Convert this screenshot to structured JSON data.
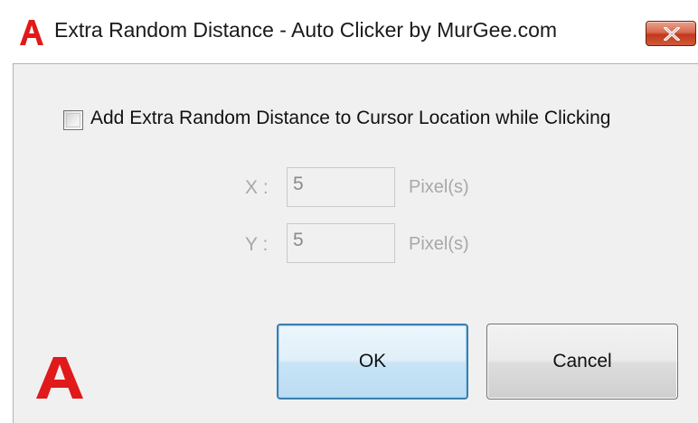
{
  "window": {
    "title": "Extra Random Distance - Auto Clicker by MurGee.com",
    "logo_icon": "murgee-a-logo-icon",
    "accent_color": "#e01a1a"
  },
  "options": {
    "random_distance_checkbox": {
      "label": "Add Extra Random Distance to Cursor Location while Clicking",
      "checked": false
    }
  },
  "fields": {
    "x": {
      "label": "X :",
      "value": "5",
      "unit": "Pixel(s)",
      "enabled": false
    },
    "y": {
      "label": "Y :",
      "value": "5",
      "unit": "Pixel(s)",
      "enabled": false
    }
  },
  "buttons": {
    "ok_label": "OK",
    "cancel_label": "Cancel"
  }
}
